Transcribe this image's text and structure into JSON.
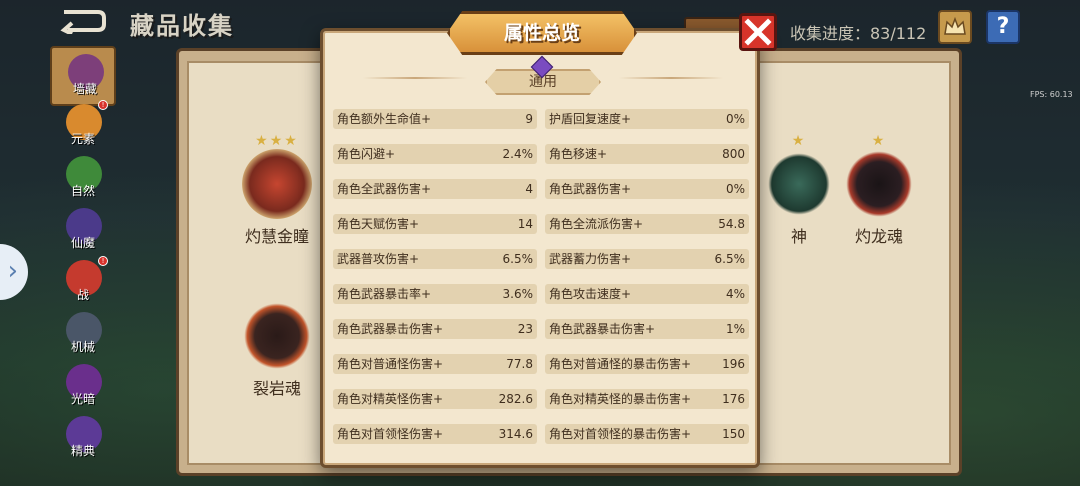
{
  "header": {
    "title": "藏品收集",
    "filter_label": "",
    "progress_label": "收集进度：83/112",
    "fps_label": "FPS: 60.13"
  },
  "sidebar": {
    "items": [
      {
        "label": "墙藏",
        "icon": "wall-collection-icon",
        "active": true,
        "badge": false
      },
      {
        "label": "元素",
        "icon": "element-icon",
        "active": false,
        "badge": true
      },
      {
        "label": "自然",
        "icon": "nature-icon",
        "active": false,
        "badge": false
      },
      {
        "label": "仙魔",
        "icon": "immortal-demon-icon",
        "active": false,
        "badge": false
      },
      {
        "label": "战",
        "icon": "battle-icon",
        "active": false,
        "badge": true
      },
      {
        "label": "机械",
        "icon": "mechanical-icon",
        "active": false,
        "badge": false
      },
      {
        "label": "光暗",
        "icon": "light-dark-icon",
        "active": false,
        "badge": false
      },
      {
        "label": "精典",
        "icon": "classic-icon",
        "active": false,
        "badge": false
      }
    ]
  },
  "collection": {
    "items": [
      {
        "name": "灼慧金瞳",
        "stars": "★★★"
      },
      {
        "name": "裂岩魂",
        "stars": ""
      },
      {
        "name": "神",
        "stars": "★"
      },
      {
        "name": "灼龙魂",
        "stars": "★"
      }
    ]
  },
  "modal": {
    "title": "属性总览",
    "tab_label": "通用",
    "stats_left": [
      {
        "label": "角色额外生命值+",
        "value": "9"
      },
      {
        "label": "角色闪避+",
        "value": "2.4%"
      },
      {
        "label": "角色全武器伤害+",
        "value": "4"
      },
      {
        "label": "角色天赋伤害+",
        "value": "14"
      },
      {
        "label": "武器普攻伤害+",
        "value": "6.5%"
      },
      {
        "label": "角色武器暴击率+",
        "value": "3.6%"
      },
      {
        "label": "角色武器暴击伤害+",
        "value": "23"
      },
      {
        "label": "角色对普通怪伤害+",
        "value": "77.8"
      },
      {
        "label": "角色对精英怪伤害+",
        "value": "282.6"
      },
      {
        "label": "角色对首领怪伤害+",
        "value": "314.6"
      }
    ],
    "stats_right": [
      {
        "label": "护盾回复速度+",
        "value": "0%"
      },
      {
        "label": "角色移速+",
        "value": "800"
      },
      {
        "label": "角色武器伤害+",
        "value": "0%"
      },
      {
        "label": "角色全流派伤害+",
        "value": "54.8"
      },
      {
        "label": "武器蓄力伤害+",
        "value": "6.5%"
      },
      {
        "label": "角色攻击速度+",
        "value": "4%"
      },
      {
        "label": "角色武器暴击伤害+",
        "value": "1%"
      },
      {
        "label": "角色对普通怪的暴击伤害+",
        "value": "196"
      },
      {
        "label": "角色对精英怪的暴击伤害+",
        "value": "176"
      },
      {
        "label": "角色对首领怪的暴击伤害+",
        "value": "150"
      }
    ]
  }
}
